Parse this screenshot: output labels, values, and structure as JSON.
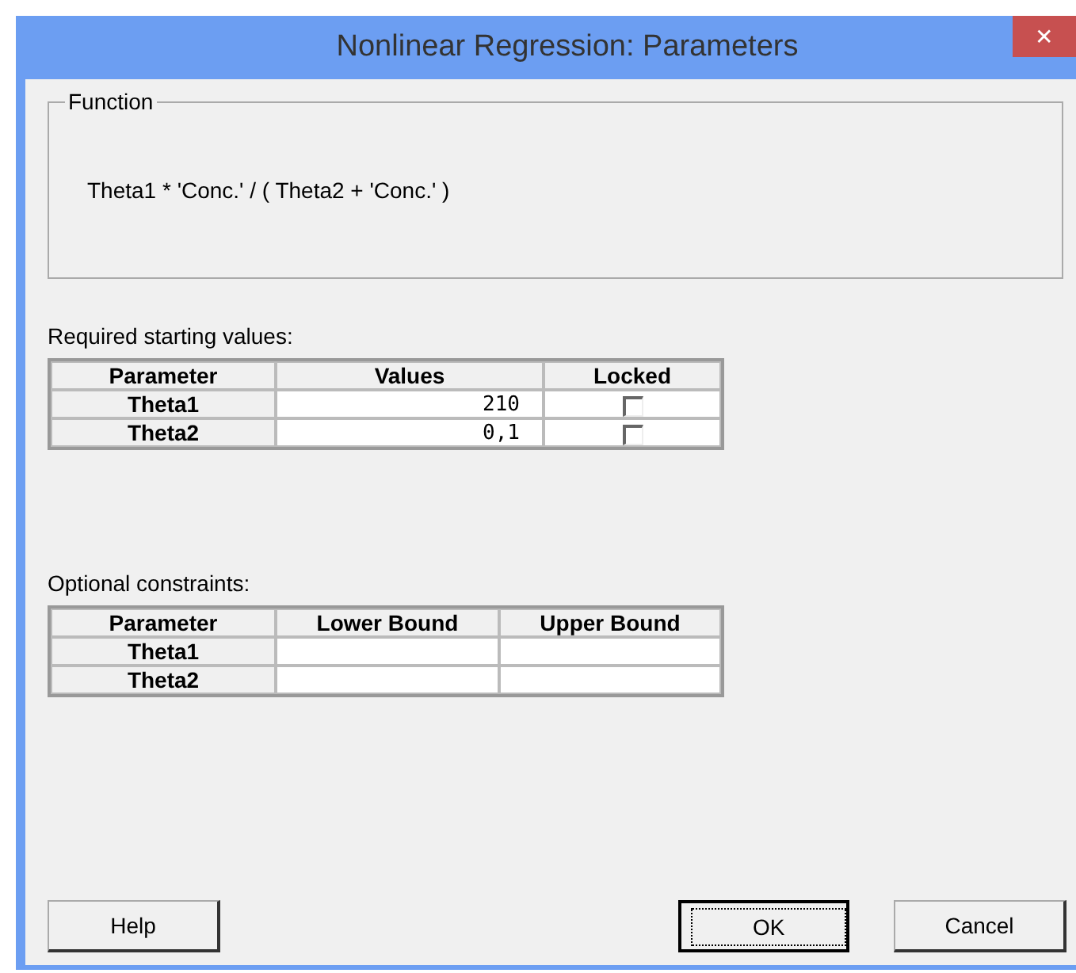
{
  "window": {
    "title": "Nonlinear Regression: Parameters",
    "close": "✕"
  },
  "function_group": {
    "label": "Function",
    "expression": "Theta1 * 'Conc.' / ( Theta2 + 'Conc.' )"
  },
  "starting_values": {
    "label": "Required starting values:",
    "columns": [
      "Parameter",
      "Values",
      "Locked"
    ],
    "rows": [
      {
        "parameter": "Theta1",
        "value": "210",
        "locked": false
      },
      {
        "parameter": "Theta2",
        "value": "0,1",
        "locked": false
      }
    ]
  },
  "constraints": {
    "label": "Optional constraints:",
    "columns": [
      "Parameter",
      "Lower Bound",
      "Upper Bound"
    ],
    "rows": [
      {
        "parameter": "Theta1"
      },
      {
        "parameter": "Theta2"
      }
    ]
  },
  "buttons": [
    {
      "label": "Help",
      "default": false
    },
    {
      "label": "OK",
      "default": true
    },
    {
      "label": "Cancel",
      "default": false
    }
  ]
}
